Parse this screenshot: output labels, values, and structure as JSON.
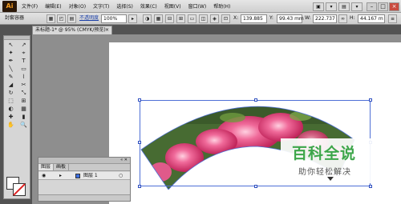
{
  "app": {
    "logo": "Ai"
  },
  "menubar": {
    "items": [
      "文件(F)",
      "编辑(E)",
      "对象(O)",
      "文字(T)",
      "选择(S)",
      "效果(C)",
      "视图(V)",
      "窗口(W)",
      "帮助(H)"
    ],
    "right_buttons": [
      "▣",
      "▾",
      "▤",
      "▾"
    ],
    "window_controls": [
      "–",
      "□",
      "×"
    ]
  },
  "controlbar": {
    "label": "封套容器",
    "opacity_label": "不透明度",
    "opacity_value": "100%",
    "x_value": "139.885",
    "y_value": "99.43 mm",
    "w_value": "222.737",
    "h_value": "44.167 m"
  },
  "document": {
    "tab_title": "未标题-1* @ 95% (CMYK/预览)",
    "close": "×"
  },
  "tools": {
    "items": [
      "↖",
      "↗",
      "✦",
      "⌖",
      "✒",
      "T",
      "╲",
      "▭",
      "✎",
      "⌇",
      "◢",
      "✂",
      "↻",
      "⤡",
      "⬚",
      "⊞",
      "◐",
      "▦",
      "✚",
      "▮",
      "✋",
      "🔍"
    ]
  },
  "layers_panel": {
    "tabs": [
      "图层",
      "画板"
    ],
    "head_controls": "«  ✕",
    "layer": {
      "name": "图层 1",
      "eye": "◉",
      "arrow": "▸",
      "target": "○"
    }
  },
  "watermark": {
    "title": "百科全说",
    "subtitle": "助你轻松解决"
  },
  "colors": {
    "accent_green": "#3da64a",
    "selection_blue": "#4e6fd6",
    "workspace_gray": "#8e8e8e"
  }
}
